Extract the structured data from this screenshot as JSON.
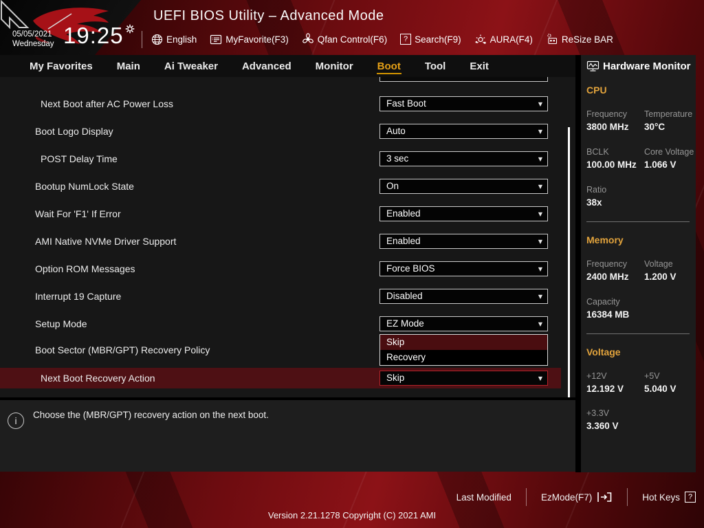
{
  "colors": {
    "accent_gold": "#e5a017",
    "section_gold": "#e2a33c",
    "highlight_row": "#4e1014",
    "highlight_option": "#4a0d10",
    "select_border": "#c9c9c9",
    "active_select_border": "#b5232a"
  },
  "header": {
    "title": "UEFI BIOS Utility – Advanced Mode",
    "date": "05/05/2021",
    "weekday": "Wednesday",
    "time": "19:25",
    "items": [
      {
        "label": "English",
        "icon": "globe-icon"
      },
      {
        "label": "MyFavorite(F3)",
        "icon": "favorites-list-icon"
      },
      {
        "label": "Qfan Control(F6)",
        "icon": "fan-icon"
      },
      {
        "label": "Search(F9)",
        "icon": "question-box-icon"
      },
      {
        "label": "AURA(F4)",
        "icon": "aura-light-icon"
      },
      {
        "label": "ReSize BAR",
        "icon": "resize-bar-chip-icon"
      }
    ]
  },
  "tabs": {
    "active": "Boot",
    "items": [
      "My Favorites",
      "Main",
      "Ai Tweaker",
      "Advanced",
      "Monitor",
      "Boot",
      "Tool",
      "Exit"
    ]
  },
  "settings": {
    "rows": [
      {
        "label": "Next Boot after AC Power Loss",
        "value": "Fast Boot"
      },
      {
        "label": "Boot Logo Display",
        "value": "Auto"
      },
      {
        "label": "POST Delay Time",
        "value": "3 sec"
      },
      {
        "label": "Bootup NumLock State",
        "value": "On"
      },
      {
        "label": "Wait For 'F1' If Error",
        "value": "Enabled"
      },
      {
        "label": "AMI Native NVMe Driver Support",
        "value": "Enabled"
      },
      {
        "label": "Option ROM Messages",
        "value": "Force BIOS"
      },
      {
        "label": "Interrupt 19 Capture",
        "value": "Disabled"
      },
      {
        "label": "Setup Mode",
        "value": "EZ Mode"
      },
      {
        "label": "Boot Sector (MBR/GPT) Recovery Policy",
        "value": ""
      },
      {
        "label": "Next Boot Recovery Action",
        "value": "Skip"
      }
    ],
    "open_dropdown": {
      "for": "Next Boot Recovery Action",
      "selected": "Skip",
      "options": [
        "Skip",
        "Recovery"
      ]
    }
  },
  "info": {
    "text": "Choose the (MBR/GPT) recovery action on the next boot."
  },
  "hardware_monitor": {
    "title": "Hardware Monitor",
    "sections": [
      {
        "name": "CPU",
        "fields": [
          {
            "label": "Frequency",
            "value": "3800 MHz"
          },
          {
            "label": "Temperature",
            "value": "30°C"
          },
          {
            "label": "BCLK",
            "value": "100.00 MHz"
          },
          {
            "label": "Core Voltage",
            "value": "1.066 V"
          },
          {
            "label": "Ratio",
            "value": "38x"
          }
        ]
      },
      {
        "name": "Memory",
        "fields": [
          {
            "label": "Frequency",
            "value": "2400 MHz"
          },
          {
            "label": "Voltage",
            "value": "1.200 V"
          },
          {
            "label": "Capacity",
            "value": "16384 MB"
          }
        ]
      },
      {
        "name": "Voltage",
        "fields": [
          {
            "label": "+12V",
            "value": "12.192 V"
          },
          {
            "label": "+5V",
            "value": "5.040 V"
          },
          {
            "label": "+3.3V",
            "value": "3.360 V"
          }
        ]
      }
    ]
  },
  "footer": {
    "last_modified": "Last Modified",
    "ezmode": "EzMode(F7)",
    "hotkeys": "Hot Keys",
    "version": "Version 2.21.1278 Copyright (C) 2021 AMI"
  },
  "glyphs": {
    "question": "?",
    "info": "i",
    "dropdown_arrow": "▼"
  }
}
